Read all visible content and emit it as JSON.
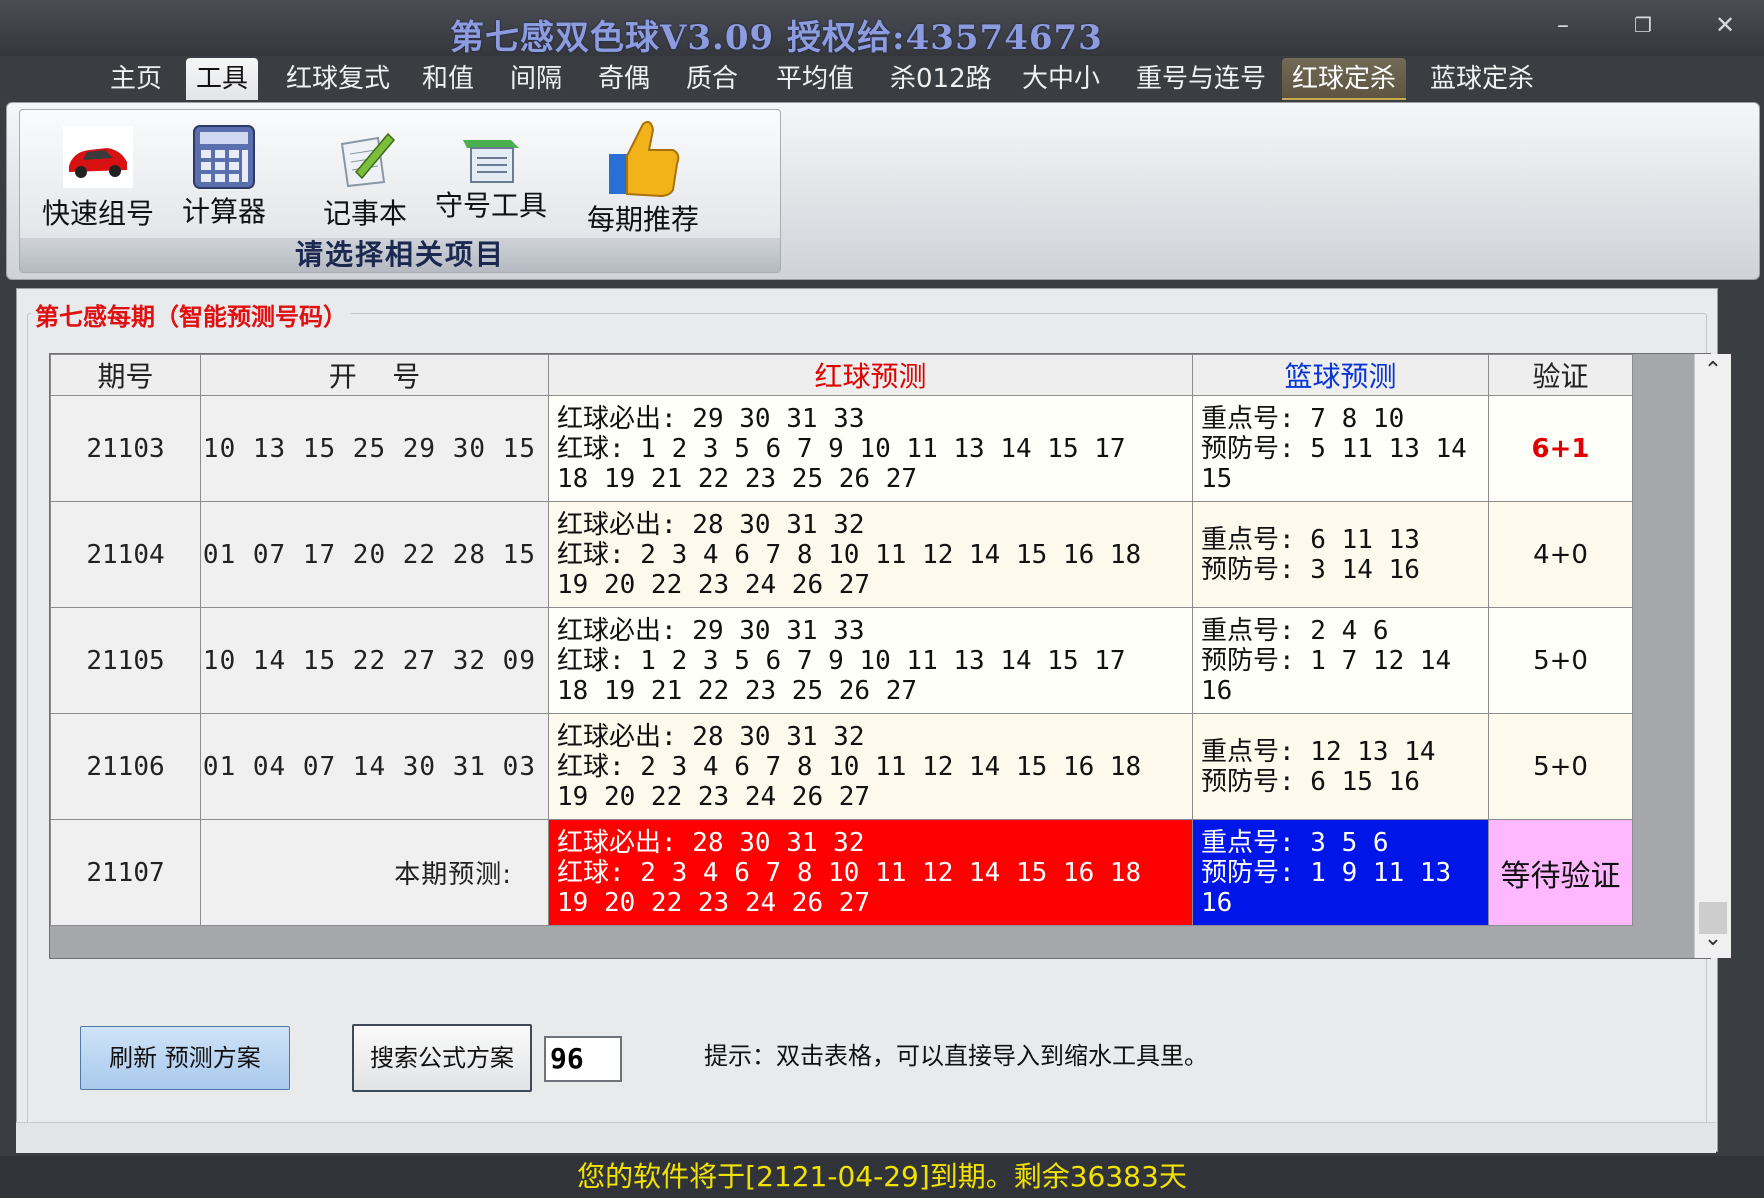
{
  "window": {
    "title": "第七感双色球V3.09  授权给:43574673",
    "minimize": "–",
    "maximize": "❐",
    "close": "✕"
  },
  "tabs": [
    {
      "label": "主页"
    },
    {
      "label": "工具",
      "state": "active"
    },
    {
      "label": "红球复式"
    },
    {
      "label": "和值"
    },
    {
      "label": "间隔"
    },
    {
      "label": "奇偶"
    },
    {
      "label": "质合"
    },
    {
      "label": "平均值"
    },
    {
      "label": "杀012路"
    },
    {
      "label": "大中小"
    },
    {
      "label": "重号与连号"
    },
    {
      "label": "红球定杀",
      "state": "highlight"
    },
    {
      "label": "蓝球定杀"
    }
  ],
  "ribbon": {
    "buttons": [
      {
        "label": "快速组号",
        "icon": "red-car-icon"
      },
      {
        "label": "计算器",
        "icon": "calculator-icon"
      },
      {
        "label": "记事本",
        "icon": "notepad-pen-icon"
      },
      {
        "label": "守号工具",
        "icon": "green-document-icon"
      },
      {
        "label": "每期推荐",
        "icon": "thumbs-up-icon"
      }
    ],
    "group_label": "请选择相关项目"
  },
  "panel": {
    "heading": "第七感每期（智能预测号码）"
  },
  "grid": {
    "headers": {
      "issue": "期号",
      "open": "开    号",
      "red": "红球预测",
      "blue": "篮球预测",
      "verify": "验证"
    },
    "header_colors": {
      "red": "#e00000",
      "blue": "#0a35d6"
    },
    "rows": [
      {
        "issue": "21103",
        "open": "10 13 15 25 29 30 15",
        "red": "红球必出: 29 30 31 33\n红球: 1 2 3 5 6 7 9 10 11 13 14 15 17\n18 19 21 22 23 25 26 27",
        "blue": "重点号: 7 8 10\n预防号: 5 11 13 14\n15",
        "verify": "6+1"
      },
      {
        "issue": "21104",
        "open": "01 07 17 20 22 28 15",
        "red": "红球必出: 28 30 31 32\n红球: 2 3 4 6 7 8 10 11 12 14 15 16 18\n19 20 22 23 24 26 27",
        "blue": "重点号: 6 11 13\n预防号: 3 14 16",
        "verify": "4+0"
      },
      {
        "issue": "21105",
        "open": "10 14 15 22 27 32 09",
        "red": "红球必出: 29 30 31 33\n红球: 1 2 3 5 6 7 9 10 11 13 14 15 17\n18 19 21 22 23 25 26 27",
        "blue": "重点号: 2 4 6\n预防号: 1 7 12 14\n16",
        "verify": "5+0"
      },
      {
        "issue": "21106",
        "open": "01 04 07 14 30 31 03",
        "red": "红球必出: 28 30 31 32\n红球: 2 3 4 6 7 8 10 11 12 14 15 16 18\n19 20 22 23 24 26 27",
        "blue": "重点号: 12 13 14\n预防号: 6 15 16",
        "verify": "5+0"
      },
      {
        "issue": "21107",
        "open": "本期预测:",
        "red": "红球必出: 28 30 31 32\n红球: 2 3 4 6 7 8 10 11 12 14 15 16 18\n19 20 22 23 24 26 27",
        "blue": "重点号: 3 5 6\n预防号: 1 9 11 13\n16",
        "verify": "等待验证"
      }
    ],
    "scroll_up": "⌃",
    "scroll_down": "⌄"
  },
  "controls": {
    "refresh_label": "刷新 预测方案",
    "search_label": "搜索公式方案",
    "number_value": "96",
    "hint": "提示：双击表格，可以直接导入到缩水工具里。"
  },
  "status": "您的软件将于[2121-04-29]到期。剩余36383天",
  "colors": {
    "current_red_bg": "#ff0000",
    "current_blue_bg": "#0015e8",
    "waiting_bg": "#ffb8ff",
    "hit_text": "#e00000",
    "status_text": "#f2e200"
  }
}
